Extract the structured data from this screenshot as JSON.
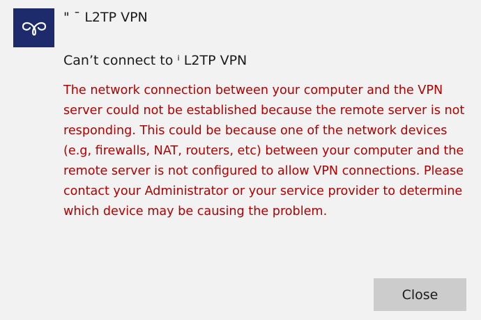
{
  "dialog": {
    "title": "\" ˉ L2TP VPN",
    "subtitle": "Can’t connect to ⁱ L2TP VPN",
    "message": "The network connection between your computer and the VPN server could not be established because the remote server is not responding. This could be because one of the network devices (e.g, firewalls, NAT, routers, etc) between your computer and the remote server is not configured to allow VPN connections. Please contact your Administrator or your service provider to determine which device may be causing the problem.",
    "close_label": "Close",
    "icon": "vpn-knot-icon",
    "colors": {
      "background": "#f2f2f2",
      "icon_tile": "#1d2a6b",
      "error_text": "#b00000",
      "button": "#cccccc"
    }
  }
}
